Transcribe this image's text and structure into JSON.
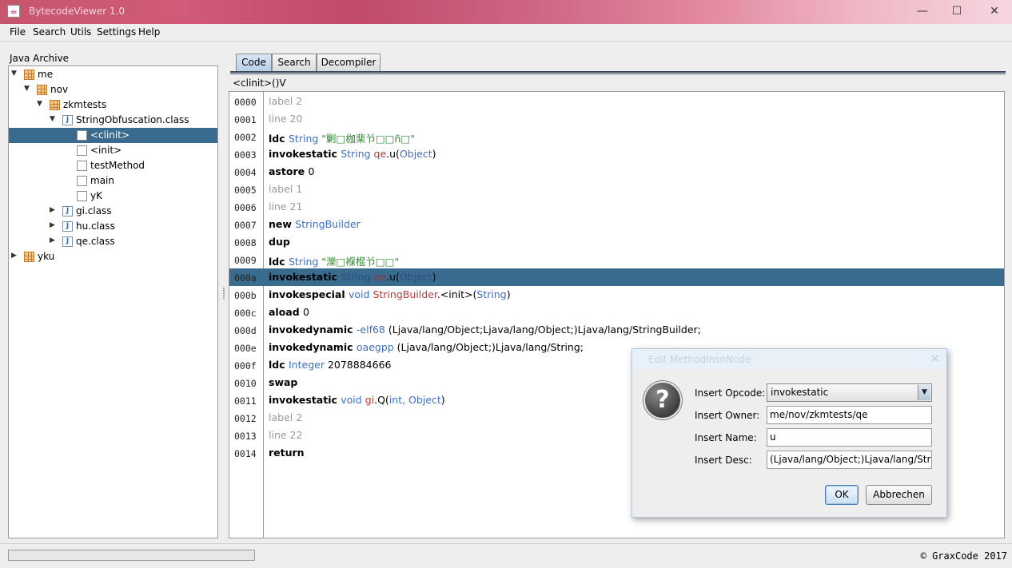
{
  "window": {
    "title": "BytecodeViewer 1.0",
    "minimize": "—",
    "maximize": "☐",
    "close": "✕"
  },
  "menu": [
    "File",
    "Search",
    "Utils",
    "Settings",
    "Help"
  ],
  "left_panel": {
    "title": "Java Archive",
    "tree": [
      {
        "label": "me",
        "type": "package",
        "depth": 0,
        "expanded": true
      },
      {
        "label": "nov",
        "type": "package",
        "depth": 1,
        "expanded": true
      },
      {
        "label": "zkmtests",
        "type": "package",
        "depth": 2,
        "expanded": true
      },
      {
        "label": "StringObfuscation.class",
        "type": "class",
        "depth": 3,
        "expanded": true
      },
      {
        "label": "<clinit>",
        "type": "method",
        "depth": 4,
        "selected": true
      },
      {
        "label": "<init>",
        "type": "method",
        "depth": 4
      },
      {
        "label": "testMethod",
        "type": "method",
        "depth": 4
      },
      {
        "label": "main",
        "type": "method",
        "depth": 4
      },
      {
        "label": "yK",
        "type": "method",
        "depth": 4
      },
      {
        "label": "gi.class",
        "type": "class",
        "depth": 3,
        "expanded": false
      },
      {
        "label": "hu.class",
        "type": "class",
        "depth": 3,
        "expanded": false
      },
      {
        "label": "qe.class",
        "type": "class",
        "depth": 3,
        "expanded": false
      },
      {
        "label": "yku",
        "type": "package",
        "depth": 0,
        "expanded": false
      }
    ]
  },
  "right_panel": {
    "tabs": [
      "Code",
      "Search",
      "Decompiler"
    ],
    "active_tab": "Code",
    "method_signature": "<clinit>()V",
    "selected_row": 10,
    "lines": [
      {
        "num": "0000",
        "parts": [
          [
            "lab",
            "label 2"
          ]
        ]
      },
      {
        "num": "0001",
        "parts": [
          [
            "lab",
            "line 20"
          ]
        ]
      },
      {
        "num": "0002",
        "parts": [
          [
            "op",
            "ldc "
          ],
          [
            "t",
            "String "
          ],
          [
            "s",
            "\"剿□枷棐兯□□ñ□\""
          ]
        ]
      },
      {
        "num": "0003",
        "parts": [
          [
            "op",
            "invokestatic "
          ],
          [
            "t",
            "String "
          ],
          [
            "o",
            "qe"
          ],
          [
            "n",
            ".u("
          ],
          [
            "t",
            "Object"
          ],
          [
            "n",
            ")"
          ]
        ]
      },
      {
        "num": "0004",
        "parts": [
          [
            "op",
            "astore "
          ],
          [
            "n",
            "0"
          ]
        ]
      },
      {
        "num": "0005",
        "parts": [
          [
            "lab",
            "label 1"
          ]
        ]
      },
      {
        "num": "0006",
        "parts": [
          [
            "lab",
            "line 21"
          ]
        ]
      },
      {
        "num": "0007",
        "parts": [
          [
            "op",
            "new "
          ],
          [
            "t",
            "StringBuilder"
          ]
        ]
      },
      {
        "num": "0008",
        "parts": [
          [
            "op",
            "dup"
          ]
        ]
      },
      {
        "num": "0009",
        "parts": [
          [
            "op",
            "ldc "
          ],
          [
            "t",
            "String "
          ],
          [
            "s",
            "\"濼□褓棍兯□□\""
          ]
        ]
      },
      {
        "num": "000a",
        "parts": [
          [
            "op",
            "invokestatic "
          ],
          [
            "t",
            "String "
          ],
          [
            "o",
            "qe"
          ],
          [
            "n",
            ".u("
          ],
          [
            "t",
            "Object"
          ],
          [
            "n",
            ")"
          ]
        ]
      },
      {
        "num": "000b",
        "parts": [
          [
            "op",
            "invokespecial "
          ],
          [
            "t",
            "void "
          ],
          [
            "o",
            "StringBuilder"
          ],
          [
            "n",
            ".<init>("
          ],
          [
            "t",
            "String"
          ],
          [
            "n",
            ")"
          ]
        ]
      },
      {
        "num": "000c",
        "parts": [
          [
            "op",
            "aload "
          ],
          [
            "n",
            "0"
          ]
        ]
      },
      {
        "num": "000d",
        "parts": [
          [
            "op",
            "invokedynamic "
          ],
          [
            "t",
            "-elf68 "
          ],
          [
            "n",
            "(Ljava/lang/Object;Ljava/lang/Object;)Ljava/lang/StringBuilder;"
          ]
        ]
      },
      {
        "num": "000e",
        "parts": [
          [
            "op",
            "invokedynamic "
          ],
          [
            "t",
            "oaegpp "
          ],
          [
            "n",
            "(Ljava/lang/Object;)Ljava/lang/String;"
          ]
        ]
      },
      {
        "num": "000f",
        "parts": [
          [
            "op",
            "ldc "
          ],
          [
            "t",
            "Integer "
          ],
          [
            "n",
            "2078884666"
          ]
        ]
      },
      {
        "num": "0010",
        "parts": [
          [
            "op",
            "swap"
          ]
        ]
      },
      {
        "num": "0011",
        "parts": [
          [
            "op",
            "invokestatic "
          ],
          [
            "t",
            "void "
          ],
          [
            "o",
            "gi"
          ],
          [
            "n",
            ".Q("
          ],
          [
            "t",
            "int, Object"
          ],
          [
            "n",
            ")"
          ]
        ]
      },
      {
        "num": "0012",
        "parts": [
          [
            "lab",
            "label 2"
          ]
        ]
      },
      {
        "num": "0013",
        "parts": [
          [
            "lab",
            "line 22"
          ]
        ]
      },
      {
        "num": "0014",
        "parts": [
          [
            "op",
            "return"
          ]
        ]
      }
    ]
  },
  "dialog": {
    "title": "Edit MethodInsnNode",
    "close": "✕",
    "icon": "question-icon",
    "opcode_label": "Insert Opcode:",
    "opcode_value": "invokestatic",
    "owner_label": "Insert Owner:",
    "owner_value": "me/nov/zkmtests/qe",
    "name_label": "Insert Name:",
    "name_value": "u",
    "desc_label": "Insert Desc:",
    "desc_value": "(Ljava/lang/Object;)Ljava/lang/String;",
    "ok_label": "OK",
    "cancel_label": "Abbrechen"
  },
  "status": {
    "progress": 0,
    "copyright": "© GraxCode 2017"
  }
}
